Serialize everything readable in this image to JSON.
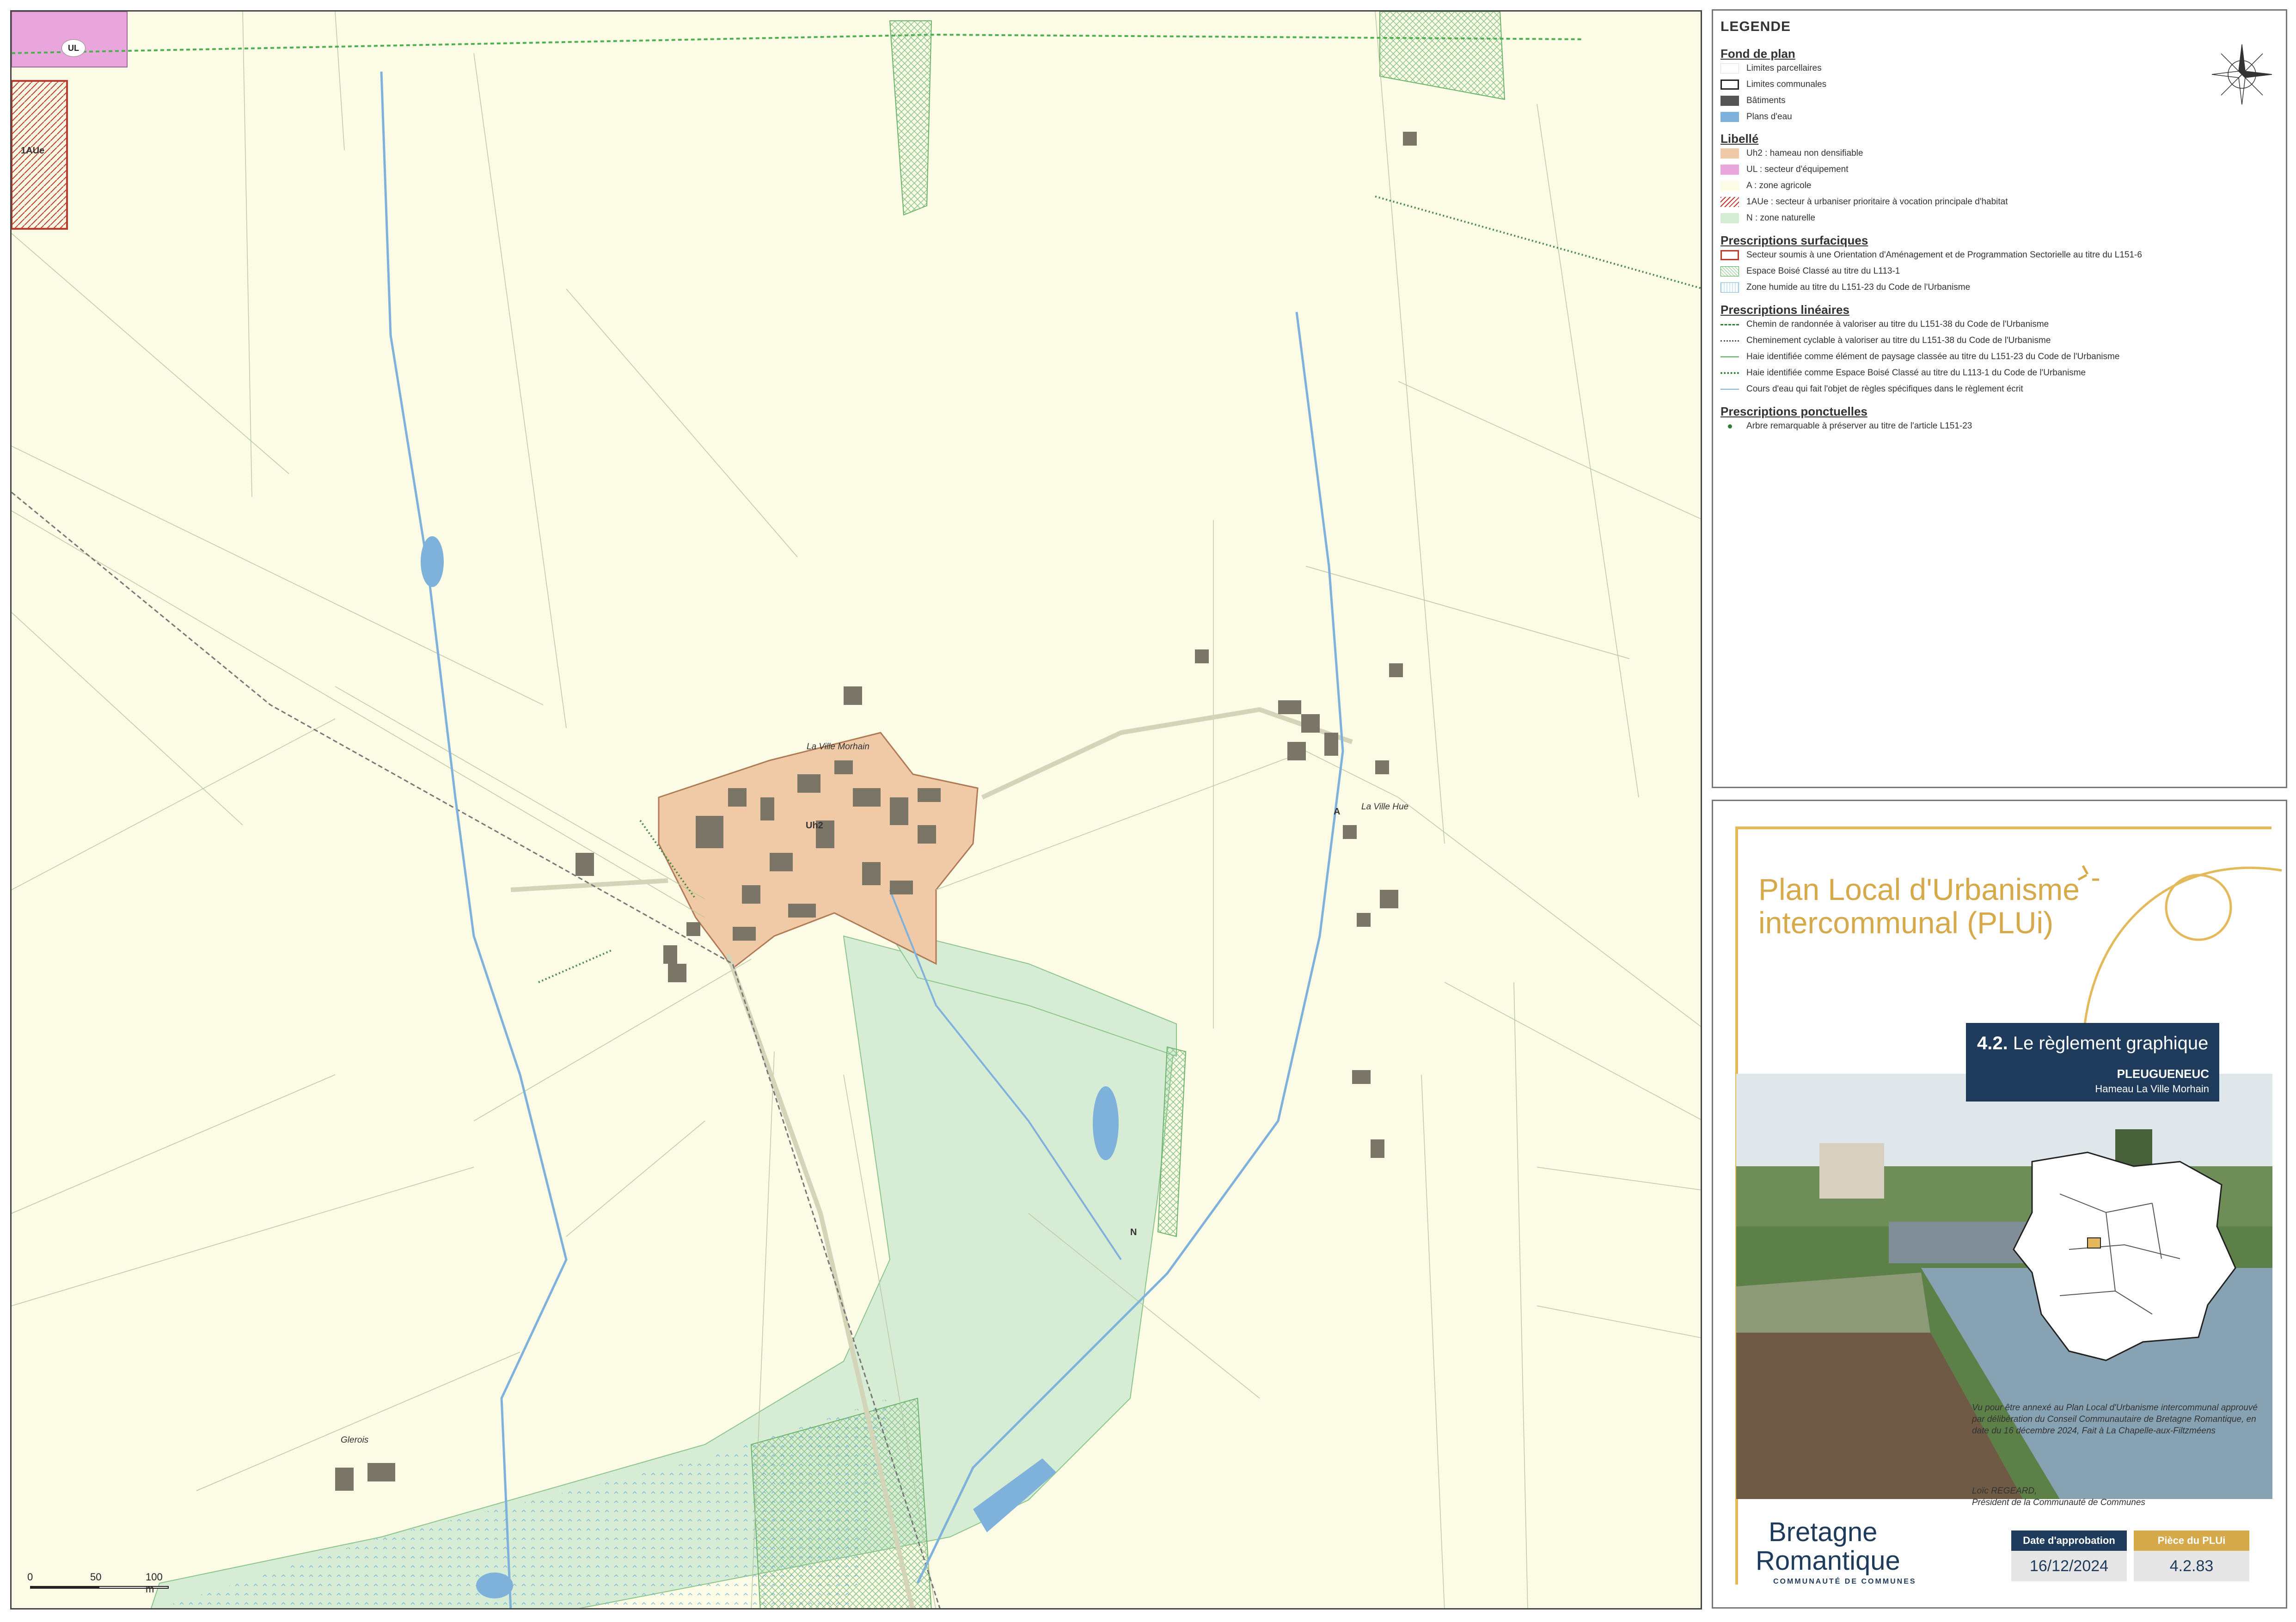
{
  "map": {
    "places": [
      "La Ville Morhain",
      "La Ville Hue",
      "Glerois"
    ],
    "zones": [
      "UL",
      "1AUe",
      "Uh2"
    ],
    "point_markers": [
      "A",
      "N"
    ],
    "scale_ticks": [
      "0",
      "50",
      "100 m"
    ]
  },
  "legend": {
    "title": "LEGENDE",
    "sections": {
      "fond_de_plan": "Fond de plan",
      "libelle": "Libellé",
      "surfaciques": "Prescriptions surfaciques",
      "lineaires": "Prescriptions linéaires",
      "ponctuelles": "Prescriptions ponctuelles"
    },
    "fond_items": [
      "Limites parcellaires",
      "Limites communales",
      "Bâtiments",
      "Plans d'eau"
    ],
    "libelle_items": [
      "Uh2 : hameau non densifiable",
      "UL : secteur d'équipement",
      "A : zone agricole",
      "1AUe : secteur à urbaniser prioritaire à vocation principale d'habitat",
      "N : zone naturelle"
    ],
    "surfaciques_items": [
      "Secteur soumis à une Orientation d'Aménagement et de Programmation Sectorielle au titre du L151-6",
      "Espace Boisé Classé au titre du L113-1",
      "Zone humide au titre du L151-23 du Code de l'Urbanisme"
    ],
    "lineaires_items": [
      "Chemin de randonnée à valoriser au titre du L151-38 du Code de l'Urbanisme",
      "Cheminement cyclable à valoriser au titre du L151-38 du Code de l'Urbanisme",
      "Haie identifiée comme élément de paysage classée au titre du L151-23 du Code de l'Urbanisme",
      "Haie identifiée comme Espace Boisé Classé au titre du L113-1 du Code de l'Urbanisme",
      "Cours d'eau qui fait l'objet de règles spécifiques dans le règlement écrit"
    ],
    "ponctuelles_items": [
      "Arbre remarquable à préserver au titre de l'article L151-23"
    ],
    "colors": {
      "uh2": "#f0c9a6",
      "ul": "#e8a6dc",
      "n": "#d6ecd4",
      "a": "#fbfbe6",
      "water": "#7fb2db",
      "buildings": "#555555",
      "oap": "#c0392b",
      "hedge": "#4caf50"
    }
  },
  "cartouche": {
    "title_line1": "Plan Local d'Urbanisme",
    "title_line2": "intercommunal (PLUi)",
    "piece_num": "4.2.",
    "piece_title": "Le règlement graphique",
    "commune": "PLEUGUENEUC",
    "hameau": "Hameau La Ville Morhain",
    "approval_text": "Vu pour être annexé au Plan Local d'Urbanisme intercommunal approuvé par délibération du Conseil Communautaire de Bretagne Romantique, en date du 16 décembre 2024, Fait à La Chapelle-aux-Filtzméens",
    "signatory": "Loïc REGEARD,",
    "signatory_role": "Président de la Communauté de Communes",
    "logo_line1": "Bretagne",
    "logo_line2": "Romantique",
    "logo_line3": "COMMUNAUTÉ DE COMMUNES",
    "approval_label": "Date d'approbation",
    "approval_date": "16/12/2024",
    "piece_label": "Pièce du PLUi",
    "piece_value": "4.2.83"
  }
}
